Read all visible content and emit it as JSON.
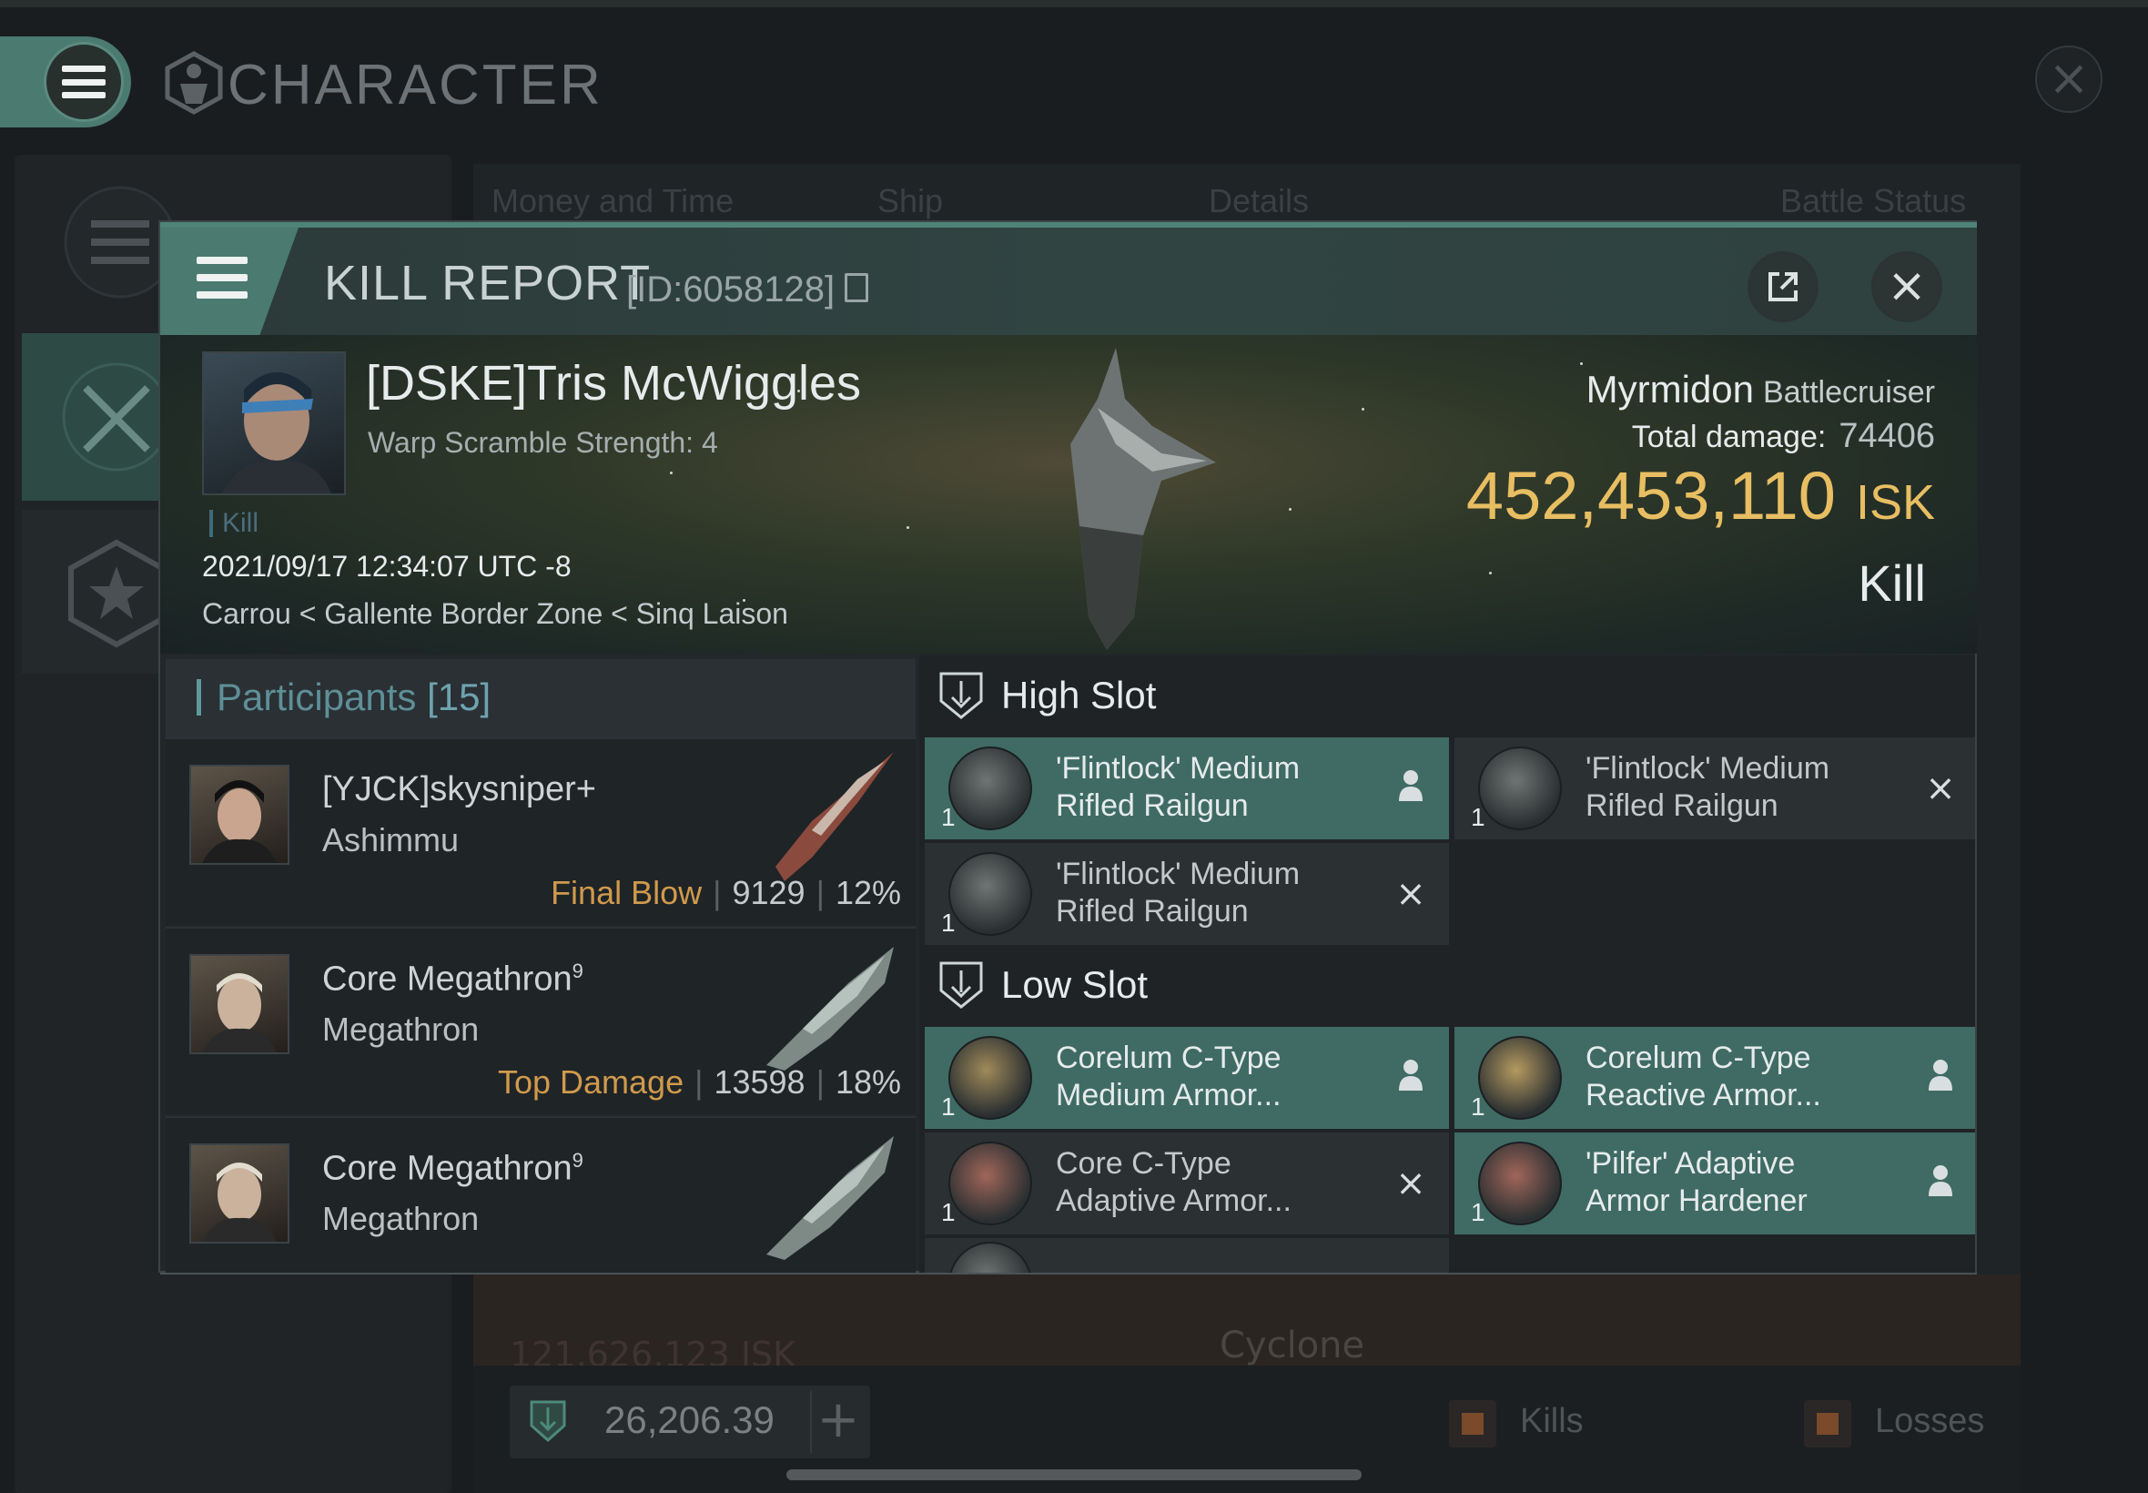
{
  "header": {
    "title": "CHARACTER"
  },
  "background": {
    "tabs": [
      "Money and Time",
      "Ship",
      "Details",
      "Battle Status"
    ],
    "isk_row": "121,626,123 ISK",
    "ship_row": "Cyclone",
    "wallet_value": "26,206.39",
    "legend_kills": "Kills",
    "legend_losses": "Losses"
  },
  "kill_report": {
    "title": "KILL REPORT",
    "id_text": "[ID:6058128]",
    "victim": {
      "name": "[DSKE]Tris McWiggles",
      "warp": "Warp Scramble Strength: 4",
      "tag": "Kill",
      "datetime": "2021/09/17 12:34:07 UTC -8",
      "location": "Carrou < Gallente Border Zone < Sinq Laison",
      "ship": "Myrmidon",
      "ship_class": "Battlecruiser",
      "total_damage_label": "Total damage:",
      "total_damage": "74406",
      "isk_value": "452,453,110",
      "isk_unit": "ISK",
      "result": "Kill"
    },
    "participants": {
      "label": "Participants",
      "count": "[15]",
      "rows": [
        {
          "name": "[YJCK]skysniper+",
          "sup": "",
          "ship": "Ashimmu",
          "tag": "Final Blow",
          "damage": "9129",
          "pct": "12%"
        },
        {
          "name": "Core Megathron",
          "sup": "9",
          "ship": "Megathron",
          "tag": "Top Damage",
          "damage": "13598",
          "pct": "18%"
        },
        {
          "name": "Core Megathron",
          "sup": "9",
          "ship": "Megathron",
          "tag": "",
          "damage": "",
          "pct": ""
        }
      ]
    },
    "high_slot": {
      "label": "High Slot",
      "modules": [
        {
          "line1": "'Flintlock' Medium",
          "line2": "Rifled Railgun",
          "qty": "1",
          "state": "dropped"
        },
        {
          "line1": "'Flintlock' Medium",
          "line2": "Rifled Railgun",
          "qty": "1",
          "state": "destroyed"
        },
        {
          "line1": "'Flintlock' Medium",
          "line2": "Rifled Railgun",
          "qty": "1",
          "state": "destroyed"
        }
      ]
    },
    "low_slot": {
      "label": "Low Slot",
      "modules": [
        {
          "line1": "Corelum C-Type",
          "line2": "Medium Armor...",
          "qty": "1",
          "state": "dropped"
        },
        {
          "line1": "Corelum C-Type",
          "line2": "Reactive Armor...",
          "qty": "1",
          "state": "dropped"
        },
        {
          "line1": "Core C-Type",
          "line2": "Adaptive Armor...",
          "qty": "1",
          "state": "destroyed"
        },
        {
          "line1": "'Pilfer' Adaptive",
          "line2": "Armor Hardener",
          "qty": "1",
          "state": "dropped"
        }
      ]
    }
  },
  "colors": {
    "accent": "#4a7a70",
    "isk": "#e8be62",
    "dropped": "#3f6b64"
  }
}
